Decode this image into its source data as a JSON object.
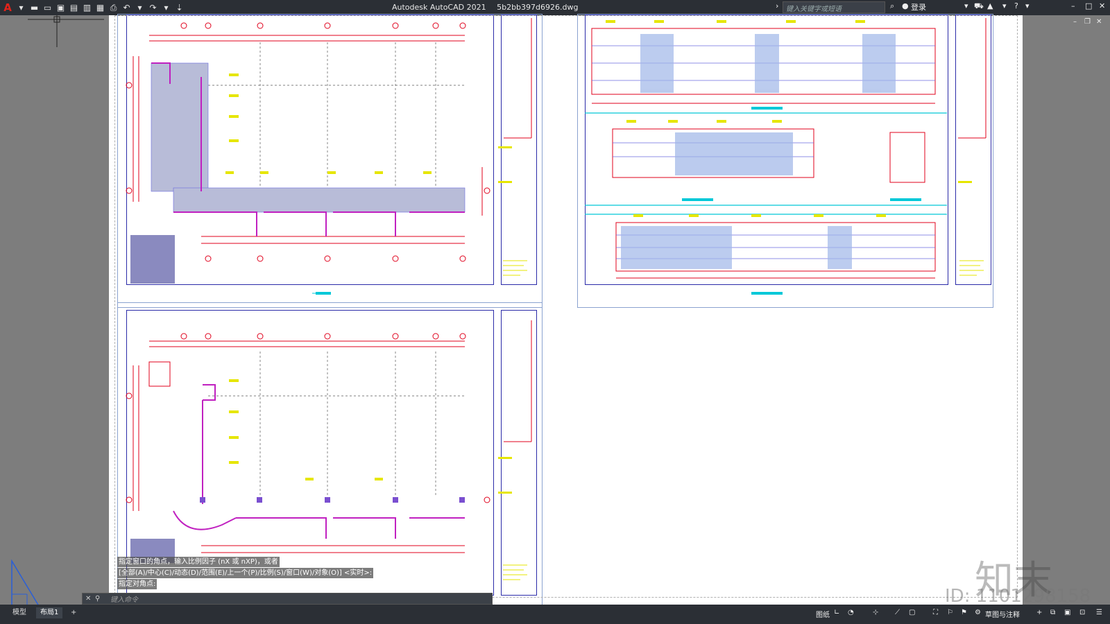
{
  "app": {
    "title": "Autodesk AutoCAD 2021",
    "filename": "5b2bb397d6926.dwg",
    "search_placeholder": "键入关键字或短语",
    "login_label": "登录"
  },
  "layout_tabs": [
    {
      "label": "模型"
    },
    {
      "label": "布局1"
    },
    {
      "label": "+"
    }
  ],
  "command": {
    "history": [
      "指定窗口的角点，输入比例因子 (nX 或 nXP)，或者",
      "[全部(A)/中心(C)/动态(D)/范围(E)/上一个(P)/比例(S)/窗口(W)/对象(O)] <实时>:",
      "指定对角点:"
    ],
    "placeholder": "键入命令"
  },
  "status_bar": {
    "space_label": "图纸",
    "workspace_label": "草图与注释"
  },
  "watermark": {
    "brand": "知末",
    "id_text": "ID: 1101298158",
    "site": "znzmo.com"
  },
  "colors": {
    "titlebar": "#2b2f35",
    "paper": "#ffffff",
    "drawing_red": "#e0001b",
    "drawing_blue": "#1f1fb0",
    "drawing_magenta": "#c020c0",
    "drawing_cyan": "#00c8d8",
    "drawing_yellow": "#e6e600"
  }
}
